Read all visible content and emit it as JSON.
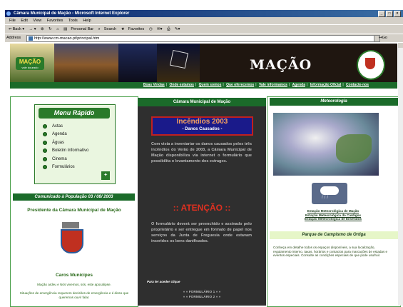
{
  "window": {
    "title": "Câmara Municipal de Mação - Microsoft Internet Explorer"
  },
  "menubar": [
    "File",
    "Edit",
    "View",
    "Favorites",
    "Tools",
    "Help"
  ],
  "toolbar": {
    "back": "Back",
    "personal_bar": "Personal Bar",
    "search": "Search",
    "favorites": "Favorites"
  },
  "address": {
    "label": "Address",
    "url": "http://www.cm-macao.pt/principal.htm",
    "go": "Go"
  },
  "banner": {
    "logo_text": "MAÇÃO",
    "logo_sub": "vale dourado",
    "title": "MAÇÃO"
  },
  "nav": [
    "Boas Vindas",
    "Onde estamos",
    "Quem somos",
    "Que oferecemos",
    "Vale informamos",
    "Agenda",
    "Informação Oficial",
    "Contacte-nos"
  ],
  "left": {
    "menu_title": "Menu Rápido",
    "menu_items": [
      "Actas",
      "Agenda",
      "Águas",
      "Boletim Informativo",
      "Cinema",
      "Formulários"
    ],
    "comunicado": "Comunicado à População 03 / 08/ 2003",
    "presidente": "Presidente da Câmara Municipal de Mação",
    "caros": "Caros Munícipes",
    "para1": "Mação ardeu e Nós vivemos, sós, este apocalipse.",
    "para2": "Situações de emergência requerem decisões de emergência e é disso que queremos ouvir falar."
  },
  "middle": {
    "header": "Câmara Municipal de Mação",
    "incendios": "Incêndios 2003",
    "danos": "- Danos Causados -",
    "text1": "Com vista a inventariar os danos causados pelos três incêndios do Verão de 2003, a Câmara Municipal de Mação disponibiliza via internet o formulário que possibilita o levantamento dos estragos.",
    "atencao": ":: ATENÇÃO ::",
    "text2": "O formulário deverá ser preenchido e assinado pelo proprietário e ser entregue em formato de papel nos serviços da Junta de Freguesia onde estavam inseridos os bens danificados.",
    "link": "Para ler aceder clique",
    "arrow1": "« « FORMULÁRIO 1 » »",
    "arrow2": "« « FORMULÁRIO 2 » »"
  },
  "right": {
    "header": "Meteorologia",
    "links": [
      "Estação Meteorológica de Mação",
      "Estação Meteorológica do Cardigos",
      "Estação Meteorológica de Envendos"
    ],
    "header2": "Parque de Campismo de Ortiga",
    "text": "Conheça em detalhe todos os espaços disponíveis, a sua localização, regulamento interno, taxas, horários e contactos para marcações de estadas e eventos especiais. Consulte as condições especiais de que pode usufruir."
  },
  "colors": {
    "green": "#1b6b2a",
    "dark": "#2f2f2f",
    "red": "#e03020",
    "light_green": "#eaf6e0"
  }
}
